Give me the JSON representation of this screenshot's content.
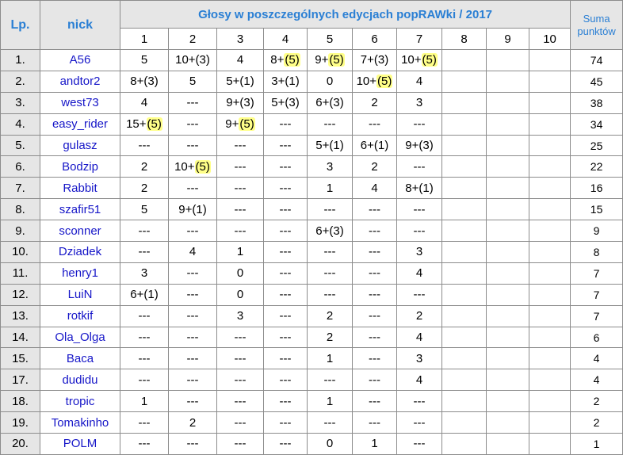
{
  "header": {
    "lp": "Lp.",
    "nick": "nick",
    "title": "Głosy w poszczególnych edycjach popRAWki / 2017",
    "sum_line1": "Suma",
    "sum_line2": "punktów",
    "editions": [
      "1",
      "2",
      "3",
      "4",
      "5",
      "6",
      "7",
      "8",
      "9",
      "10"
    ]
  },
  "colors": {
    "header_text": "#2a7fd4",
    "nick_text": "#1616c8",
    "header_bg": "#e6e6e6",
    "highlight": "#ffff88"
  },
  "rows": [
    {
      "lp": "1.",
      "nick": "A56",
      "cells": [
        "5",
        "10+(3)",
        "4",
        "8+(5)",
        "9+(5)",
        "7+(3)",
        "10+(5)",
        "",
        "",
        ""
      ],
      "sum": "74"
    },
    {
      "lp": "2.",
      "nick": "andtor2",
      "cells": [
        "8+(3)",
        "5",
        "5+(1)",
        "3+(1)",
        "0",
        "10+(5)",
        "4",
        "",
        "",
        ""
      ],
      "sum": "45"
    },
    {
      "lp": "3.",
      "nick": "west73",
      "cells": [
        "4",
        "---",
        "9+(3)",
        "5+(3)",
        "6+(3)",
        "2",
        "3",
        "",
        "",
        ""
      ],
      "sum": "38"
    },
    {
      "lp": "4.",
      "nick": "easy_rider",
      "cells": [
        "15+(5)",
        "---",
        "9+(5)",
        "---",
        "---",
        "---",
        "---",
        "",
        "",
        ""
      ],
      "sum": "34"
    },
    {
      "lp": "5.",
      "nick": "gulasz",
      "cells": [
        "---",
        "---",
        "---",
        "---",
        "5+(1)",
        "6+(1)",
        "9+(3)",
        "",
        "",
        ""
      ],
      "sum": "25"
    },
    {
      "lp": "6.",
      "nick": "Bodzip",
      "cells": [
        "2",
        "10+(5)",
        "---",
        "---",
        "3",
        "2",
        "---",
        "",
        "",
        ""
      ],
      "sum": "22"
    },
    {
      "lp": "7.",
      "nick": "Rabbit",
      "cells": [
        "2",
        "---",
        "---",
        "---",
        "1",
        "4",
        "8+(1)",
        "",
        "",
        ""
      ],
      "sum": "16"
    },
    {
      "lp": "8.",
      "nick": "szafir51",
      "cells": [
        "5",
        "9+(1)",
        "---",
        "---",
        "---",
        "---",
        "---",
        "",
        "",
        ""
      ],
      "sum": "15"
    },
    {
      "lp": "9.",
      "nick": "sconner",
      "cells": [
        "---",
        "---",
        "---",
        "---",
        "6+(3)",
        "---",
        "---",
        "",
        "",
        ""
      ],
      "sum": "9"
    },
    {
      "lp": "10.",
      "nick": "Dziadek",
      "cells": [
        "---",
        "4",
        "1",
        "---",
        "---",
        "---",
        "3",
        "",
        "",
        ""
      ],
      "sum": "8"
    },
    {
      "lp": "11.",
      "nick": "henry1",
      "cells": [
        "3",
        "---",
        "0",
        "---",
        "---",
        "---",
        "4",
        "",
        "",
        ""
      ],
      "sum": "7"
    },
    {
      "lp": "12.",
      "nick": "LuiN",
      "cells": [
        "6+(1)",
        "---",
        "0",
        "---",
        "---",
        "---",
        "---",
        "",
        "",
        ""
      ],
      "sum": "7"
    },
    {
      "lp": "13.",
      "nick": "rotkif",
      "cells": [
        "---",
        "---",
        "3",
        "---",
        "2",
        "---",
        "2",
        "",
        "",
        ""
      ],
      "sum": "7"
    },
    {
      "lp": "14.",
      "nick": "Ola_Olga",
      "cells": [
        "---",
        "---",
        "---",
        "---",
        "2",
        "---",
        "4",
        "",
        "",
        ""
      ],
      "sum": "6"
    },
    {
      "lp": "15.",
      "nick": "Baca",
      "cells": [
        "---",
        "---",
        "---",
        "---",
        "1",
        "---",
        "3",
        "",
        "",
        ""
      ],
      "sum": "4"
    },
    {
      "lp": "17.",
      "nick": "dudidu",
      "cells": [
        "---",
        "---",
        "---",
        "---",
        "---",
        "---",
        "4",
        "",
        "",
        ""
      ],
      "sum": "4"
    },
    {
      "lp": "18.",
      "nick": "tropic",
      "cells": [
        "1",
        "---",
        "---",
        "---",
        "1",
        "---",
        "---",
        "",
        "",
        ""
      ],
      "sum": "2"
    },
    {
      "lp": "19.",
      "nick": "Tomakinho",
      "cells": [
        "---",
        "2",
        "---",
        "---",
        "---",
        "---",
        "---",
        "",
        "",
        ""
      ],
      "sum": "2"
    },
    {
      "lp": "20.",
      "nick": "POLM",
      "cells": [
        "---",
        "---",
        "---",
        "---",
        "0",
        "1",
        "---",
        "",
        "",
        ""
      ],
      "sum": "1"
    }
  ]
}
